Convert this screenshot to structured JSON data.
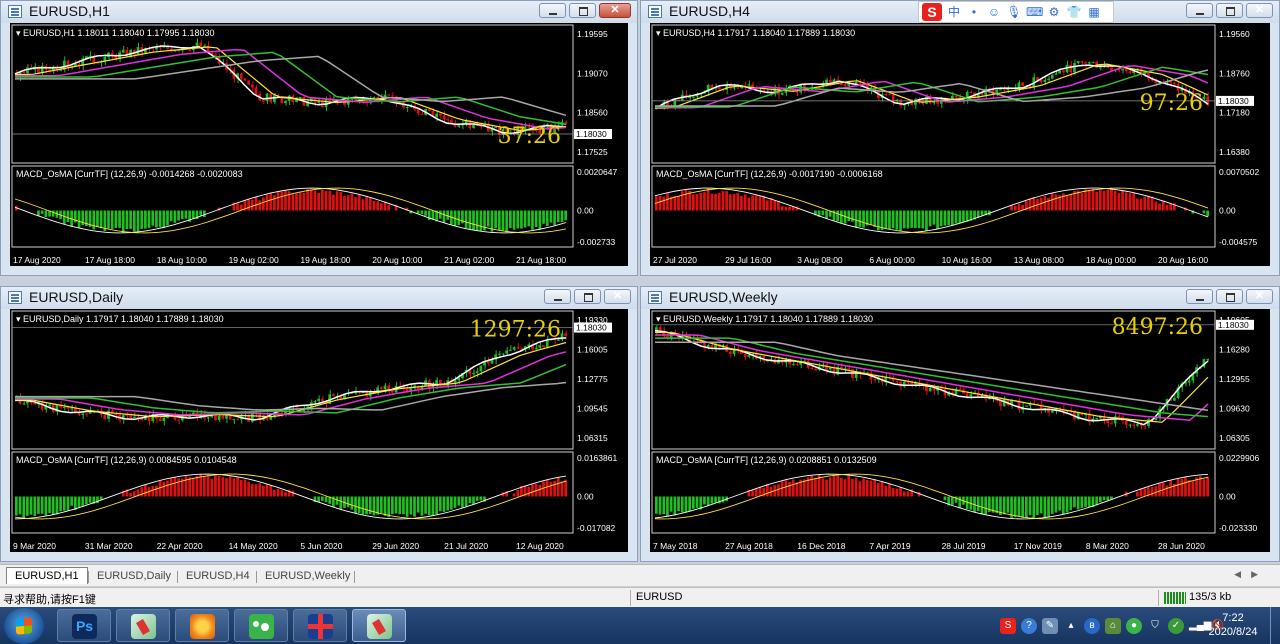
{
  "windows": [
    {
      "title": "EURUSD,H1",
      "header": "EURUSD,H1  1.18011 1.18040 1.17995 1.18030",
      "macd_label": "MACD_OsMA [CurrTF] (12,26,9) -0.0014268 -0.0020083",
      "timer": "37:26",
      "price_tag": "1.18030",
      "price_scale": [
        "1.19595",
        "1.19070",
        "1.18560",
        "1.17525"
      ],
      "macd_scale": [
        "0.0020647",
        "0.00",
        "-0.002733"
      ],
      "time_labels": [
        "17 Aug 2020",
        "17 Aug 18:00",
        "18 Aug 10:00",
        "19 Aug 02:00",
        "19 Aug 18:00",
        "20 Aug 10:00",
        "21 Aug 02:00",
        "21 Aug 18:00"
      ]
    },
    {
      "title": "EURUSD,H4",
      "header": "EURUSD,H4  1.17917 1.18040 1.17889 1.18030",
      "macd_label": "MACD_OsMA [CurrTF] (12,26,9) -0.0017190 -0.0006168",
      "timer": "97:26",
      "price_tag": "1.18030",
      "price_scale": [
        "1.19560",
        "1.18760",
        "1.17180",
        "1.16380"
      ],
      "macd_scale": [
        "0.0070502",
        "0.00",
        "-0.004575"
      ],
      "time_labels": [
        "27 Jul 2020",
        "29 Jul 16:00",
        "3 Aug 08:00",
        "6 Aug 00:00",
        "10 Aug 16:00",
        "13 Aug 08:00",
        "18 Aug 00:00",
        "20 Aug 16:00"
      ]
    },
    {
      "title": "EURUSD,Daily",
      "header": "EURUSD,Daily  1.17917 1.18040 1.17889 1.18030",
      "macd_label": "MACD_OsMA [CurrTF] (12,26,9) 0.0084595 0.0104548",
      "timer": "1297:26",
      "price_tag": "1.18030",
      "price_scale": [
        "1.19330",
        "1.16005",
        "1.12775",
        "1.09545",
        "1.06315"
      ],
      "macd_scale": [
        "0.0163861",
        "0.00",
        "-0.017082"
      ],
      "time_labels": [
        "9 Mar 2020",
        "31 Mar 2020",
        "22 Apr 2020",
        "14 May 2020",
        "5 Jun 2020",
        "29 Jun 2020",
        "21 Jul 2020",
        "12 Aug 2020"
      ]
    },
    {
      "title": "EURUSD,Weekly",
      "header": "EURUSD,Weekly  1.17917 1.18040 1.17889 1.18030",
      "macd_label": "MACD_OsMA [CurrTF] (12,26,9) 0.0208851 0.0132509",
      "timer": "8497:26",
      "price_tag": "1.18030",
      "price_scale": [
        "1.19605",
        "1.16280",
        "1.12955",
        "1.09630",
        "1.06305"
      ],
      "macd_scale": [
        "0.0229906",
        "0.00",
        "-0.023330"
      ],
      "time_labels": [
        "7 May 2018",
        "27 Aug 2018",
        "16 Dec 2018",
        "7 Apr 2019",
        "28 Jul 2019",
        "17 Nov 2019",
        "8 Mar 2020",
        "28 Jun 2020"
      ]
    }
  ],
  "tabs": [
    "EURUSD,H1",
    "EURUSD,Daily",
    "EURUSD,H4",
    "EURUSD,Weekly"
  ],
  "status": {
    "help": "寻求帮助,请按F1键",
    "symbol": "EURUSD",
    "traffic": "135/3 kb"
  },
  "ime": {
    "logo": "S",
    "mode": "中"
  },
  "clock": {
    "time": "7:22",
    "date": "2020/8/24"
  },
  "taskbar": {
    "ps_label": "Ps"
  },
  "colors": {
    "candle_up": "#1fbf1f",
    "candle_down": "#e01010",
    "ma_white": "#ffffff",
    "ma_yellow": "#ffe23a",
    "ma_magenta": "#e030e0",
    "ma_green": "#30c030",
    "ma_gray": "#a8a8a8",
    "timer": "#e8d000"
  }
}
